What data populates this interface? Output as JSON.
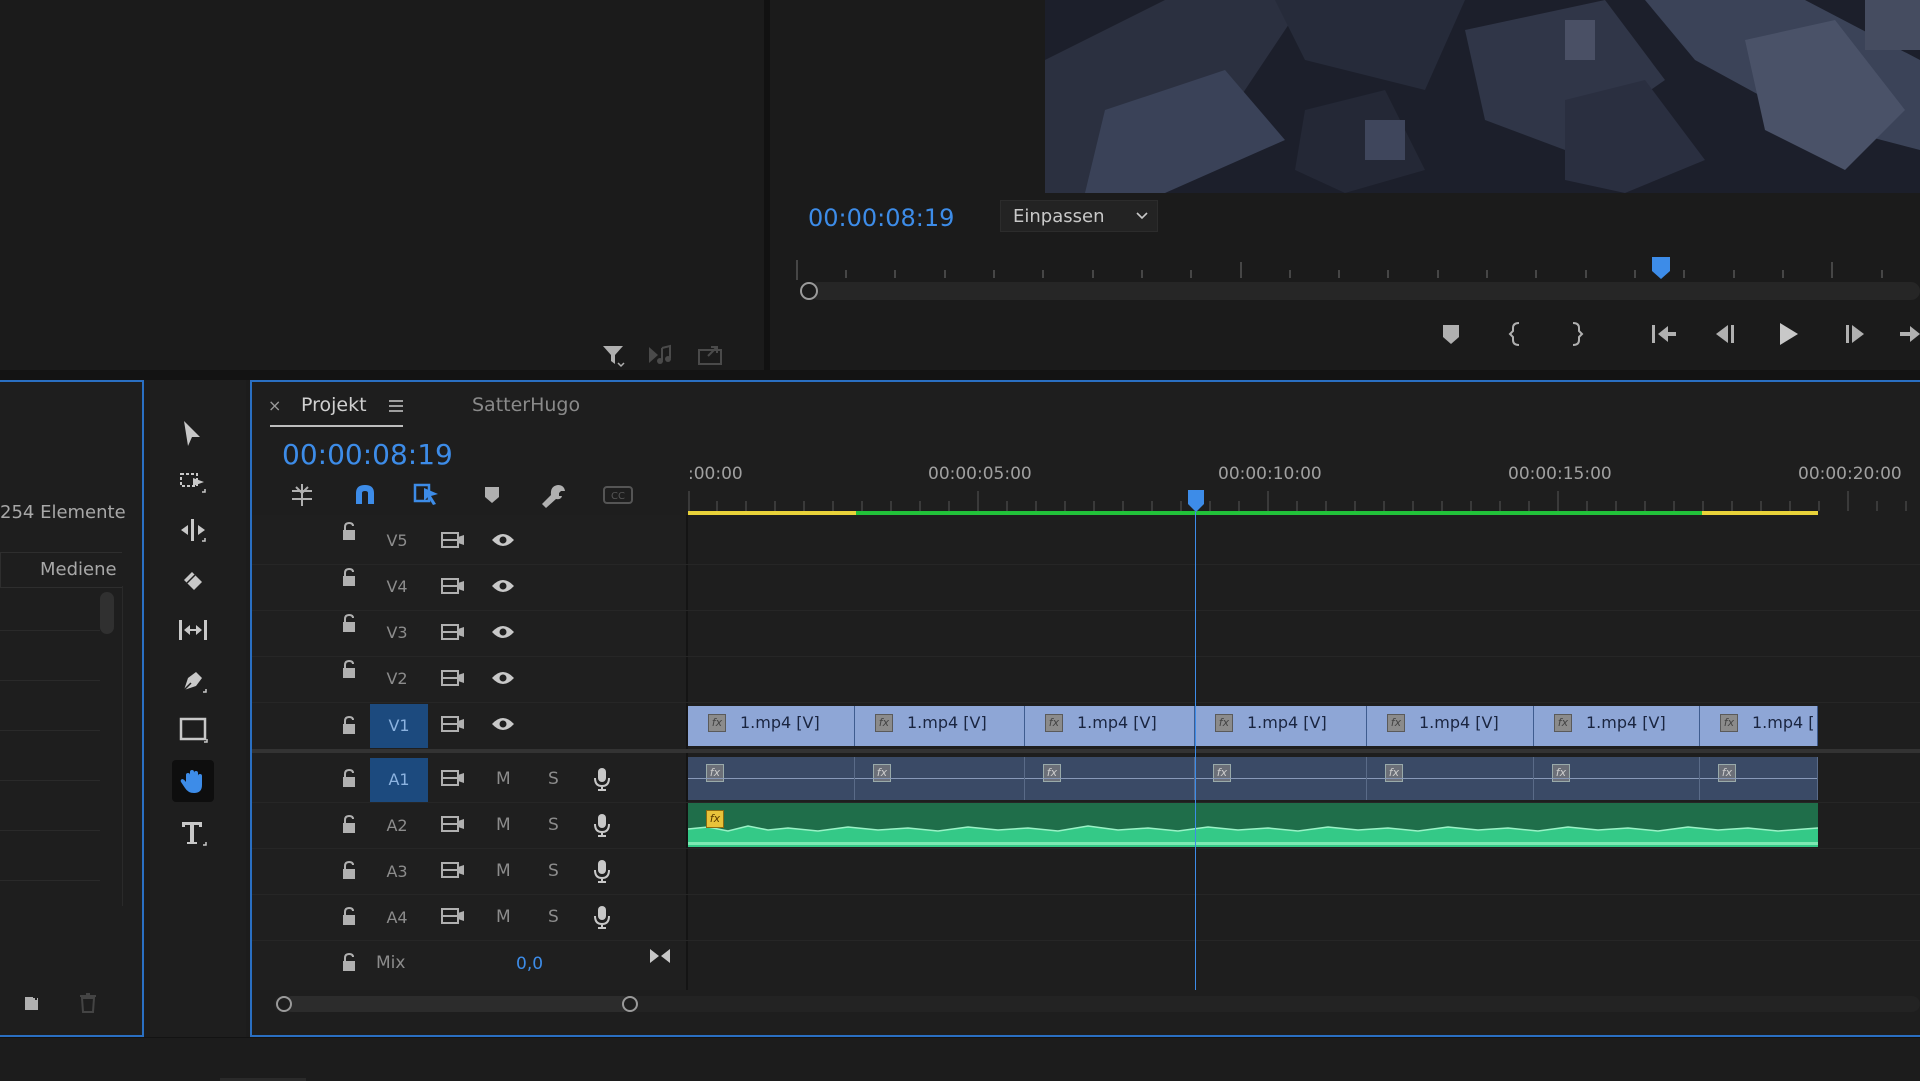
{
  "program_monitor": {
    "timecode": "00:00:08:19",
    "zoom_select": "Einpassen"
  },
  "project_panel": {
    "item_count": "254 Elemente",
    "column_header": "Mediene"
  },
  "timeline": {
    "tab_close": "×",
    "tab_active": "Projekt",
    "tab_other": "SatterHugo",
    "timecode": "00:00:08:19",
    "ruler_labels": [
      ":00:00",
      "00:00:05:00",
      "00:00:10:00",
      "00:00:15:00",
      "00:00:20:00"
    ],
    "video_tracks": [
      "V5",
      "V4",
      "V3",
      "V2",
      "V1"
    ],
    "audio_tracks": [
      "A1",
      "A2",
      "A3",
      "A4"
    ],
    "mute_label": "M",
    "solo_label": "S",
    "mix_label": "Mix",
    "mix_value": "0,0",
    "clip_names": [
      "1.mp4 [V]",
      "1.mp4 [V]",
      "1.mp4 [V]",
      "1.mp4 [V]",
      "1.mp4 [V]",
      "1.mp4 [V]",
      "1.mp4 ["
    ],
    "fx_label": "fx",
    "playhead_seconds": 8.76
  },
  "colors": {
    "accent": "#3d8ce8",
    "video_clip": "#8ea6d6",
    "audio_clip": "#3a4a66",
    "waveform": "#2fbf7a",
    "render_bar_green": "#22c23a",
    "render_bar_yellow": "#e8d23a"
  }
}
